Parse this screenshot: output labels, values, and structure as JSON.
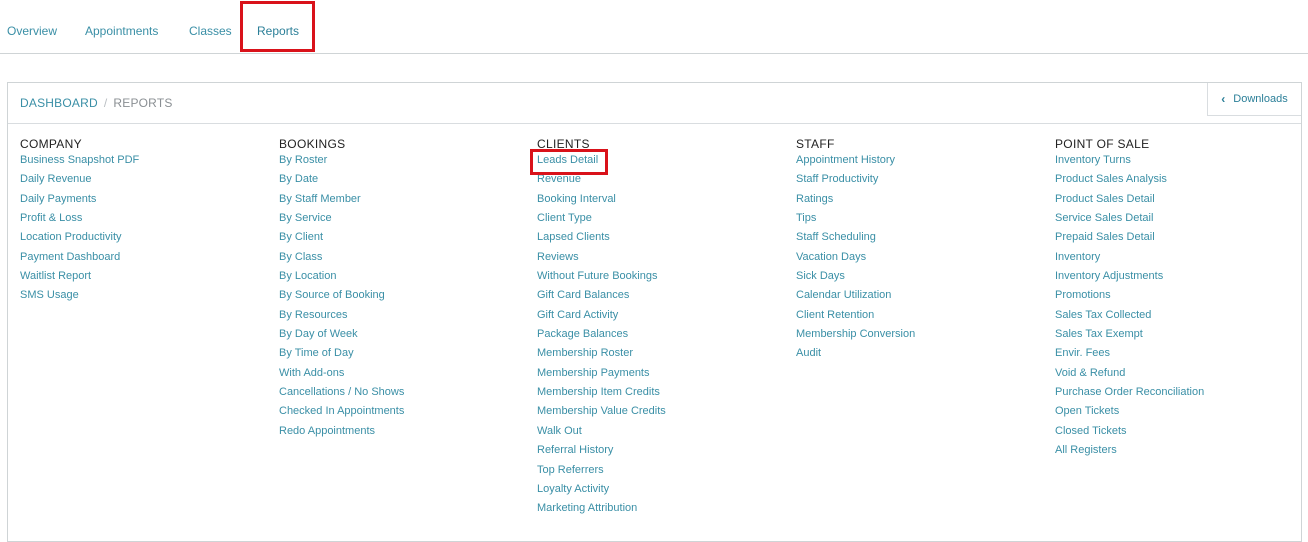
{
  "top_nav": {
    "tabs": [
      {
        "label": "Overview",
        "active": false
      },
      {
        "label": "Appointments",
        "active": false
      },
      {
        "label": "Classes",
        "active": false
      },
      {
        "label": "Reports",
        "active": true
      }
    ]
  },
  "breadcrumb": {
    "root": "DASHBOARD",
    "separator": "/",
    "current": "REPORTS"
  },
  "downloads": {
    "label": "Downloads",
    "icon": "chevron-left-icon"
  },
  "columns": [
    {
      "heading": "COMPANY",
      "items": [
        "Business Snapshot PDF",
        "Daily Revenue",
        "Daily Payments",
        "Profit & Loss",
        "Location Productivity",
        "Payment Dashboard",
        "Waitlist Report",
        "SMS Usage"
      ]
    },
    {
      "heading": "BOOKINGS",
      "items": [
        "By Roster",
        "By Date",
        "By Staff Member",
        "By Service",
        "By Client",
        "By Class",
        "By Location",
        "By Source of Booking",
        "By Resources",
        "By Day of Week",
        "By Time of Day",
        "With Add-ons",
        "Cancellations / No Shows",
        "Checked In Appointments",
        "Redo Appointments"
      ]
    },
    {
      "heading": "CLIENTS",
      "items": [
        "Leads Detail",
        "Revenue",
        "Booking Interval",
        "Client Type",
        "Lapsed Clients",
        "Reviews",
        "Without Future Bookings",
        "Gift Card Balances",
        "Gift Card Activity",
        "Package Balances",
        "Membership Roster",
        "Membership Payments",
        "Membership Item Credits",
        "Membership Value Credits",
        "Walk Out",
        "Referral History",
        "Top Referrers",
        "Loyalty Activity",
        "Marketing Attribution"
      ]
    },
    {
      "heading": "STAFF",
      "items": [
        "Appointment History",
        "Staff Productivity",
        "Ratings",
        "Tips",
        "Staff Scheduling",
        "Vacation Days",
        "Sick Days",
        "Calendar Utilization",
        "Client Retention",
        "Membership Conversion",
        "Audit"
      ]
    },
    {
      "heading": "POINT OF SALE",
      "items": [
        "Inventory Turns",
        "Product Sales Analysis",
        "Product Sales Detail",
        "Service Sales Detail",
        "Prepaid Sales Detail",
        "Inventory",
        "Inventory Adjustments",
        "Promotions",
        "Sales Tax Collected",
        "Sales Tax Exempt",
        "Envir. Fees",
        "Void & Refund",
        "Purchase Order Reconciliation",
        "Open Tickets",
        "Closed Tickets",
        "All Registers"
      ]
    }
  ],
  "colors": {
    "link": "#3a8fa6",
    "heading": "#222222",
    "highlight": "#d9121a",
    "border": "#cfd4d6"
  }
}
